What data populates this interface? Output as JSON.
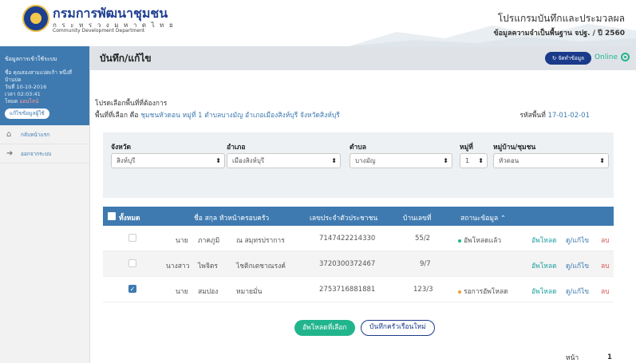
{
  "header": {
    "org_name_th": "กรมการพัฒนาชุมชน",
    "org_name_th_spaced": "ก ร ะ ท ร ว ง ม ห า ด ไ ท ย",
    "org_name_en": "Community Development Department",
    "program_title": "โปรแกรมบันทึกและประมวลผล",
    "program_subtitle": "ข้อมูลความจำเป็นพื้นฐาน จปฐ. / ปี 2560"
  },
  "sidebar": {
    "login_label": "ข้อมูลการเข้าใช้ระบบ",
    "user_name": "ชื่อ คุณสองสามแปดเก้า หนึ่งสี่",
    "user_village": "บ้านปด",
    "date": "วันที่ 10-10-2016",
    "time": "เวลา 02:03:41",
    "mode_prefix": "โหมด",
    "mode_value": "ออนไลน์",
    "edit_profile": "แก้ไขข้อมูลผู้ใช้",
    "items": [
      {
        "label": "กลับหน้าแรก",
        "icon": "home-icon"
      },
      {
        "label": "ออกจากระบบ",
        "icon": "logout-icon"
      }
    ]
  },
  "main": {
    "page_title": "บันทึก/แก้ไข",
    "status_button": "จัดทำข้อมูล",
    "online_label": "Online",
    "select_prompt": "โปรดเลือกพื้นที่ที่ต้องการ",
    "selected_area_prefix": "พื้นที่ที่เลือก คือ",
    "selected_area_value": "ชุมชนหัวดอน หมู่ที่ 1 ตำบลบางมัญ อำเภอเมืองสิงห์บุรี จังหวัดสิงห์บุรี",
    "area_code_prefix": "รหัสพื้นที่",
    "area_code_value": "17-01-02-01"
  },
  "filters": {
    "province_label": "จังหวัด",
    "province_value": "สิงห์บุรี",
    "district_label": "อำเภอ",
    "district_value": "เมืองสิงห์บุรี",
    "subdistrict_label": "ตำบล",
    "subdistrict_value": "บางมัญ",
    "moo_label": "หมู่ที่",
    "moo_value": "1",
    "village_label": "หมู่บ้าน/ชุมชน",
    "village_value": "หัวดอน"
  },
  "table": {
    "headers": {
      "all": "ทั้งหมด",
      "name": "ชื่อ สกุล หัวหน้าครอบครัว",
      "id_no": "เลขประจำตัวประชาชน",
      "house_no": "บ้านเลขที่",
      "status": "สถานะข้อมูล"
    },
    "rows": [
      {
        "title": "นาย",
        "first": "ภาคภูมิ",
        "last": "ณ สมุทรปราการ",
        "id_no": "7147422214330",
        "house_no": "55/2",
        "status": "อัพโหลดแล้ว",
        "checked": false,
        "actions": {
          "upload": "อัพโหลด",
          "view_edit": "ดู/แก้ไข",
          "delete": "ลบ"
        }
      },
      {
        "title": "นางสาว",
        "first": "ไพจิตร",
        "last": "ไชติกเตชาณรงค์",
        "id_no": "3720300372467",
        "house_no": "9/7",
        "status": "",
        "checked": false,
        "actions": {
          "upload": "อัพโหลด",
          "view_edit": "ดู/แก้ไข",
          "delete": "ลบ"
        }
      },
      {
        "title": "นาย",
        "first": "สมปอง",
        "last": "หมายมั่น",
        "id_no": "2753716881881",
        "house_no": "123/3",
        "status": "รอการอัพโหลด",
        "checked": true,
        "actions": {
          "upload": "อัพโหลด",
          "view_edit": "ดู/แก้ไข",
          "delete": "ลบ"
        }
      }
    ]
  },
  "actions": {
    "upload_selected": "อัพโหลดที่เลือก",
    "new_record": "บันทึกครัวเรือนใหม่"
  },
  "pager": {
    "label": "หน้า",
    "current": "1"
  },
  "colors": {
    "brand_blue": "#3e7ab0",
    "dark_navy": "#1a3a8a",
    "online_green": "#22b58d",
    "uploaded_green": "#22b58d",
    "pending_orange": "#f0a030"
  }
}
